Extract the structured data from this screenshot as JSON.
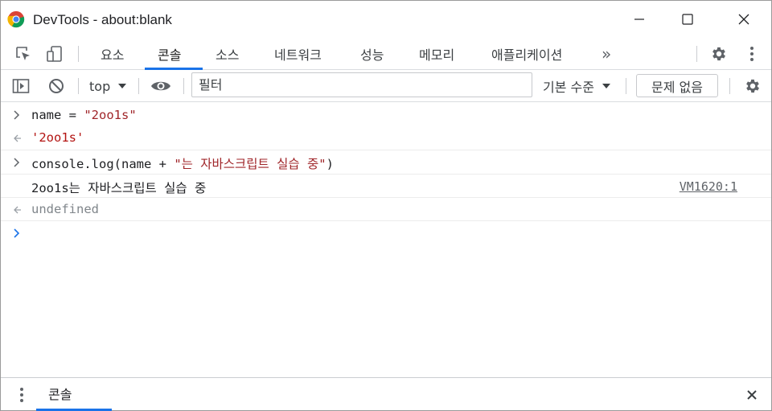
{
  "window": {
    "title": "DevTools - about:blank"
  },
  "tabs": {
    "items": [
      {
        "label": "요소"
      },
      {
        "label": "콘솔"
      },
      {
        "label": "소스"
      },
      {
        "label": "네트워크"
      },
      {
        "label": "성능"
      },
      {
        "label": "메모리"
      },
      {
        "label": "애플리케이션"
      }
    ],
    "more": "»",
    "active": "콘솔"
  },
  "console_toolbar": {
    "context": "top",
    "filter_placeholder": "필터",
    "levels": "기본 수준",
    "issues": "문제 없음"
  },
  "console": {
    "rows": [
      {
        "prefix": "name = ",
        "string": "\"2oo1s\""
      },
      {
        "result": "'2oo1s'"
      },
      {
        "prefix": "console.log(name + ",
        "string": "\"는 자바스크립트 실습 중\"",
        "suffix": ")"
      },
      {
        "output": "2oo1s는 자바스크립트 실습 중",
        "source": "VM1620:1"
      },
      {
        "result": "undefined"
      }
    ]
  },
  "drawer": {
    "tab": "콘솔"
  },
  "colors": {
    "accent": "#1a73e8",
    "string": "#a0262a",
    "prompt": "#1a73e8"
  }
}
